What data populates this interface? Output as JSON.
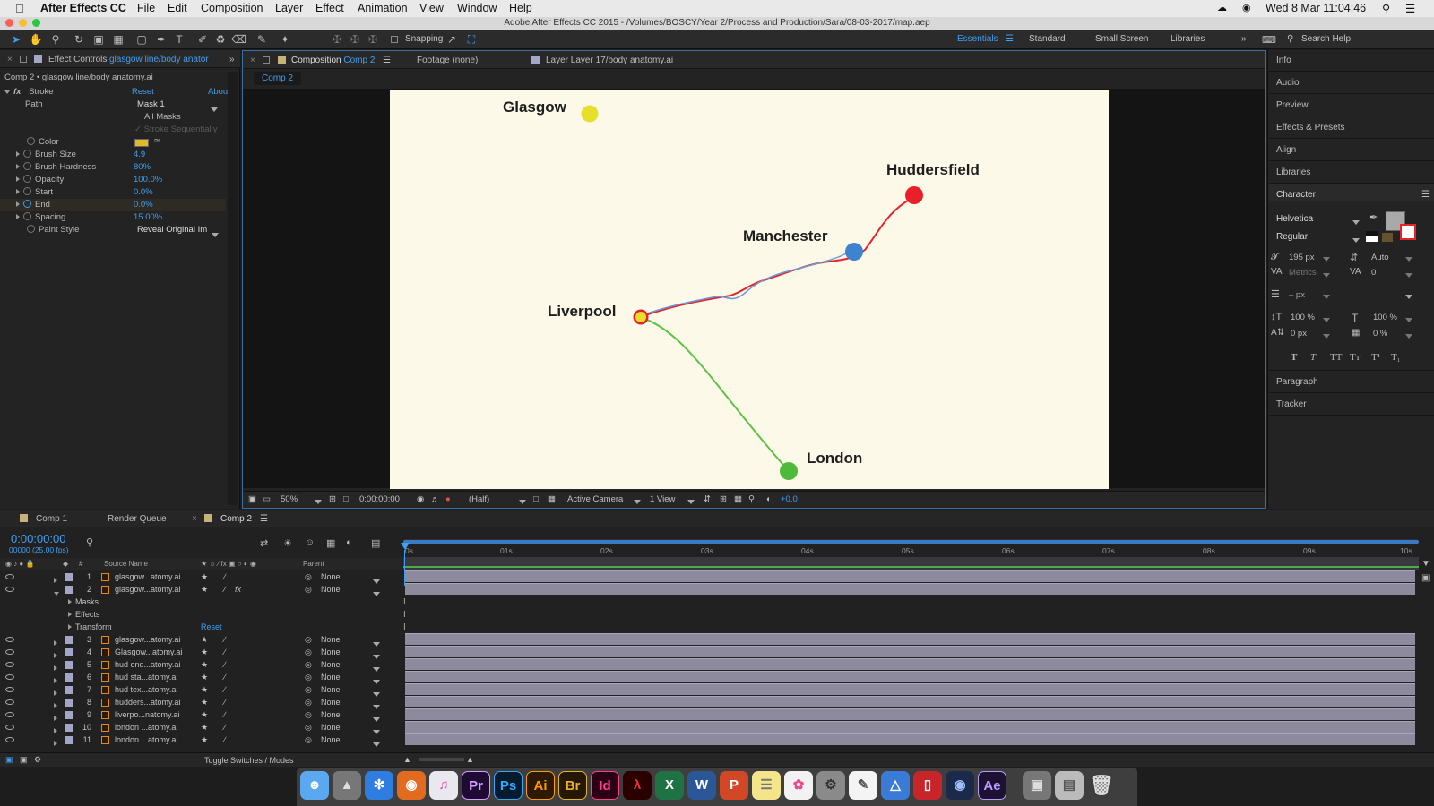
{
  "menubar": {
    "app_name": "After Effects CC",
    "menus": [
      "File",
      "Edit",
      "Composition",
      "Layer",
      "Effect",
      "Animation",
      "View",
      "Window",
      "Help"
    ],
    "clock": "Wed 8 Mar  11:04:46"
  },
  "window_title": "Adobe After Effects CC 2015 - /Volumes/BOSCY/Year 2/Process and Production/Sara/08-03-2017/map.aep",
  "toolbar": {
    "snapping_label": "Snapping",
    "workspaces": [
      "Essentials",
      "Standard",
      "Small Screen",
      "Libraries"
    ],
    "search_placeholder": "Search Help"
  },
  "effect_controls": {
    "tab_prefix": "Effect Controls",
    "tab_layer": "glasgow line/body anator",
    "breadcrumb": "Comp 2 • glasgow line/body anatomy.ai",
    "effect_name": "Stroke",
    "reset": "Reset",
    "about": "Abou",
    "path_label": "Path",
    "path_value": "Mask 1",
    "all_masks": "All Masks",
    "stroke_seq": "Stroke Sequentially",
    "color_label": "Color",
    "color_value": "#e1b82b",
    "props": [
      {
        "label": "Brush Size",
        "value": "4.9"
      },
      {
        "label": "Brush Hardness",
        "value": "80%"
      },
      {
        "label": "Opacity",
        "value": "100.0%"
      },
      {
        "label": "Start",
        "value": "0.0%"
      },
      {
        "label": "End",
        "value": "0.0%"
      },
      {
        "label": "Spacing",
        "value": "15.00%"
      }
    ],
    "paint_style_label": "Paint Style",
    "paint_style_value": "Reveal Original Im"
  },
  "viewer": {
    "tab_comp_prefix": "Composition",
    "tab_comp_name": "Comp 2",
    "tab_footage": "Footage (none)",
    "tab_layer": "Layer Layer 17/body anatomy.ai",
    "comp_chip": "Comp 2",
    "cities": {
      "glasgow": "Glasgow",
      "huddersfield": "Huddersfield",
      "manchester": "Manchester",
      "liverpool": "Liverpool",
      "london": "London"
    },
    "zoom": "50%",
    "timecode": "0:00:00:00",
    "resolution": "(Half)",
    "camera": "Active Camera",
    "views": "1 View",
    "exposure": "+0.0"
  },
  "right_panel": {
    "sections_top": [
      "Info",
      "Audio",
      "Preview",
      "Effects & Presets",
      "Align",
      "Libraries"
    ],
    "character_title": "Character",
    "font_family": "Helvetica",
    "font_style": "Regular",
    "size": "195 px",
    "leading": "Auto",
    "kerning": "Metrics",
    "tracking": "0",
    "stroke_width": "– px",
    "vscale": "100 %",
    "hscale": "100 %",
    "baseline": "0 px",
    "tsume": "0 %",
    "style_buttons": [
      "T",
      "T",
      "TT",
      "Tт",
      "T¹",
      "T₁"
    ],
    "sections_bottom": [
      "Paragraph",
      "Tracker"
    ]
  },
  "timeline": {
    "tabs": [
      "Comp 1",
      "Render Queue",
      "Comp 2"
    ],
    "timecode": "0:00:00:00",
    "frames": "00000 (25.00 fps)",
    "col_source": "Source Name",
    "col_parent": "Parent",
    "col_hash": "#",
    "ruler": [
      "0s",
      "01s",
      "02s",
      "03s",
      "04s",
      "05s",
      "06s",
      "07s",
      "08s",
      "09s",
      "10s"
    ],
    "layers_top": [
      {
        "num": "1",
        "name": "glasgow...atomy.ai",
        "parent": "None"
      },
      {
        "num": "2",
        "name": "glasgow...atomy.ai",
        "parent": "None"
      }
    ],
    "sub_groups": [
      "Masks",
      "Effects",
      "Transform"
    ],
    "transform_reset": "Reset",
    "layers_bottom": [
      {
        "num": "3",
        "name": "glasgow...atomy.ai",
        "parent": "None"
      },
      {
        "num": "4",
        "name": "Glasgow...atomy.ai",
        "parent": "None"
      },
      {
        "num": "5",
        "name": "hud end...atomy.ai",
        "parent": "None"
      },
      {
        "num": "6",
        "name": "hud sta...atomy.ai",
        "parent": "None"
      },
      {
        "num": "7",
        "name": "hud tex...atomy.ai",
        "parent": "None"
      },
      {
        "num": "8",
        "name": "hudders...atomy.ai",
        "parent": "None"
      },
      {
        "num": "9",
        "name": "liverpo...natomy.ai",
        "parent": "None"
      },
      {
        "num": "10",
        "name": "london ...atomy.ai",
        "parent": "None"
      },
      {
        "num": "11",
        "name": "london ...atomy.ai",
        "parent": "None"
      }
    ],
    "toggle_label": "Toggle Switches / Modes"
  },
  "dock": {
    "apps": [
      "Finder",
      "Launchpad",
      "Safari",
      "Firefox",
      "iTunes",
      "Pr",
      "Ps",
      "Ai",
      "Br",
      "Id",
      "Acrobat",
      "X",
      "W",
      "P",
      "Notes",
      "Photos",
      "System Preferences",
      "TextEdit",
      "Keynote",
      "SketchUp",
      "Cinema 4D",
      "Ae",
      "Image Capture",
      "Preview",
      "Trash"
    ]
  }
}
